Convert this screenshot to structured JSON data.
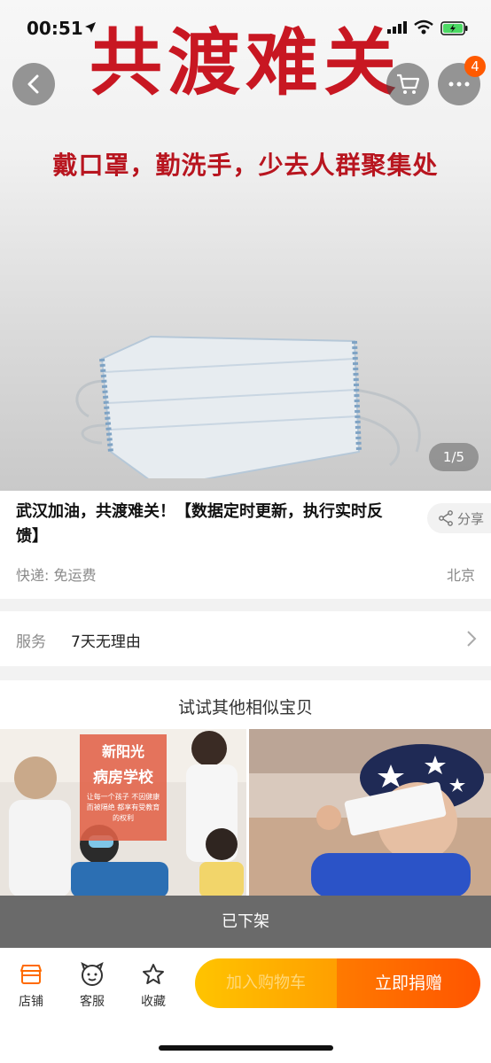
{
  "status_bar": {
    "time": "00:51"
  },
  "hero": {
    "title": "共渡难关",
    "subtitle": "戴口罩，勤洗手，少去人群聚集处",
    "image_counter": "1/5"
  },
  "top_bar": {
    "cart_badge": "4"
  },
  "product": {
    "title": "武汉加油，共渡难关！【数据定时更新，执行实时反馈】",
    "share_label": "分享",
    "shipping": "快递: 免运费",
    "location": "北京"
  },
  "service": {
    "label": "服务",
    "value": "7天无理由"
  },
  "similar": {
    "title": "试试其他相似宝贝",
    "brand_name": "新阳光",
    "brand_school": "病房学校",
    "brand_desc": "让每一个孩子 不因健康而被隔绝 都享有受教育的权利",
    "off_shelf": "已下架"
  },
  "bottom_bar": {
    "tabs": [
      {
        "label": "店铺",
        "icon": "shop-icon"
      },
      {
        "label": "客服",
        "icon": "service-icon"
      },
      {
        "label": "收藏",
        "icon": "star-icon"
      }
    ],
    "add_to_cart": "加入购物车",
    "donate": "立即捐赠"
  },
  "colors": {
    "accent": "#ff5500",
    "title_red": "#c81722",
    "badge": "#ff5a00"
  }
}
